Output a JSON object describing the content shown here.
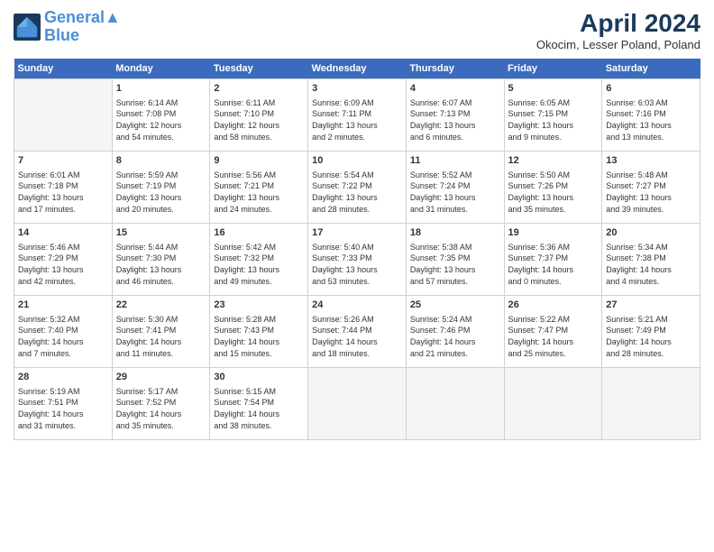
{
  "header": {
    "logo_line1": "General",
    "logo_line2": "Blue",
    "month": "April 2024",
    "location": "Okocim, Lesser Poland, Poland"
  },
  "weekdays": [
    "Sunday",
    "Monday",
    "Tuesday",
    "Wednesday",
    "Thursday",
    "Friday",
    "Saturday"
  ],
  "weeks": [
    [
      {
        "day": "",
        "info": ""
      },
      {
        "day": "1",
        "info": "Sunrise: 6:14 AM\nSunset: 7:08 PM\nDaylight: 12 hours\nand 54 minutes."
      },
      {
        "day": "2",
        "info": "Sunrise: 6:11 AM\nSunset: 7:10 PM\nDaylight: 12 hours\nand 58 minutes."
      },
      {
        "day": "3",
        "info": "Sunrise: 6:09 AM\nSunset: 7:11 PM\nDaylight: 13 hours\nand 2 minutes."
      },
      {
        "day": "4",
        "info": "Sunrise: 6:07 AM\nSunset: 7:13 PM\nDaylight: 13 hours\nand 6 minutes."
      },
      {
        "day": "5",
        "info": "Sunrise: 6:05 AM\nSunset: 7:15 PM\nDaylight: 13 hours\nand 9 minutes."
      },
      {
        "day": "6",
        "info": "Sunrise: 6:03 AM\nSunset: 7:16 PM\nDaylight: 13 hours\nand 13 minutes."
      }
    ],
    [
      {
        "day": "7",
        "info": "Sunrise: 6:01 AM\nSunset: 7:18 PM\nDaylight: 13 hours\nand 17 minutes."
      },
      {
        "day": "8",
        "info": "Sunrise: 5:59 AM\nSunset: 7:19 PM\nDaylight: 13 hours\nand 20 minutes."
      },
      {
        "day": "9",
        "info": "Sunrise: 5:56 AM\nSunset: 7:21 PM\nDaylight: 13 hours\nand 24 minutes."
      },
      {
        "day": "10",
        "info": "Sunrise: 5:54 AM\nSunset: 7:22 PM\nDaylight: 13 hours\nand 28 minutes."
      },
      {
        "day": "11",
        "info": "Sunrise: 5:52 AM\nSunset: 7:24 PM\nDaylight: 13 hours\nand 31 minutes."
      },
      {
        "day": "12",
        "info": "Sunrise: 5:50 AM\nSunset: 7:26 PM\nDaylight: 13 hours\nand 35 minutes."
      },
      {
        "day": "13",
        "info": "Sunrise: 5:48 AM\nSunset: 7:27 PM\nDaylight: 13 hours\nand 39 minutes."
      }
    ],
    [
      {
        "day": "14",
        "info": "Sunrise: 5:46 AM\nSunset: 7:29 PM\nDaylight: 13 hours\nand 42 minutes."
      },
      {
        "day": "15",
        "info": "Sunrise: 5:44 AM\nSunset: 7:30 PM\nDaylight: 13 hours\nand 46 minutes."
      },
      {
        "day": "16",
        "info": "Sunrise: 5:42 AM\nSunset: 7:32 PM\nDaylight: 13 hours\nand 49 minutes."
      },
      {
        "day": "17",
        "info": "Sunrise: 5:40 AM\nSunset: 7:33 PM\nDaylight: 13 hours\nand 53 minutes."
      },
      {
        "day": "18",
        "info": "Sunrise: 5:38 AM\nSunset: 7:35 PM\nDaylight: 13 hours\nand 57 minutes."
      },
      {
        "day": "19",
        "info": "Sunrise: 5:36 AM\nSunset: 7:37 PM\nDaylight: 14 hours\nand 0 minutes."
      },
      {
        "day": "20",
        "info": "Sunrise: 5:34 AM\nSunset: 7:38 PM\nDaylight: 14 hours\nand 4 minutes."
      }
    ],
    [
      {
        "day": "21",
        "info": "Sunrise: 5:32 AM\nSunset: 7:40 PM\nDaylight: 14 hours\nand 7 minutes."
      },
      {
        "day": "22",
        "info": "Sunrise: 5:30 AM\nSunset: 7:41 PM\nDaylight: 14 hours\nand 11 minutes."
      },
      {
        "day": "23",
        "info": "Sunrise: 5:28 AM\nSunset: 7:43 PM\nDaylight: 14 hours\nand 15 minutes."
      },
      {
        "day": "24",
        "info": "Sunrise: 5:26 AM\nSunset: 7:44 PM\nDaylight: 14 hours\nand 18 minutes."
      },
      {
        "day": "25",
        "info": "Sunrise: 5:24 AM\nSunset: 7:46 PM\nDaylight: 14 hours\nand 21 minutes."
      },
      {
        "day": "26",
        "info": "Sunrise: 5:22 AM\nSunset: 7:47 PM\nDaylight: 14 hours\nand 25 minutes."
      },
      {
        "day": "27",
        "info": "Sunrise: 5:21 AM\nSunset: 7:49 PM\nDaylight: 14 hours\nand 28 minutes."
      }
    ],
    [
      {
        "day": "28",
        "info": "Sunrise: 5:19 AM\nSunset: 7:51 PM\nDaylight: 14 hours\nand 31 minutes."
      },
      {
        "day": "29",
        "info": "Sunrise: 5:17 AM\nSunset: 7:52 PM\nDaylight: 14 hours\nand 35 minutes."
      },
      {
        "day": "30",
        "info": "Sunrise: 5:15 AM\nSunset: 7:54 PM\nDaylight: 14 hours\nand 38 minutes."
      },
      {
        "day": "",
        "info": ""
      },
      {
        "day": "",
        "info": ""
      },
      {
        "day": "",
        "info": ""
      },
      {
        "day": "",
        "info": ""
      }
    ]
  ]
}
